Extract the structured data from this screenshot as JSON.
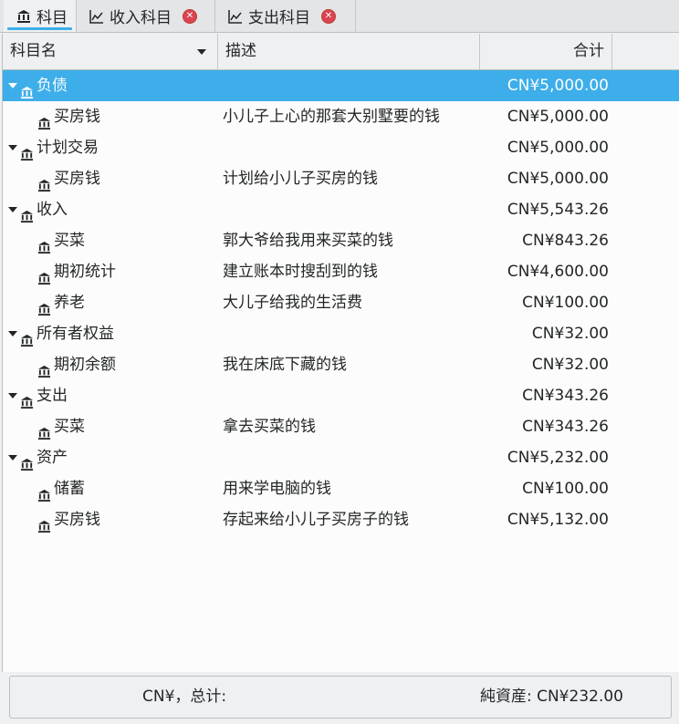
{
  "tabs": [
    {
      "label": "科目",
      "icon": "bank-icon",
      "active": true,
      "closable": false
    },
    {
      "label": "收入科目",
      "icon": "chart-icon",
      "active": false,
      "closable": true
    },
    {
      "label": "支出科目",
      "icon": "chart-icon",
      "active": false,
      "closable": true
    }
  ],
  "columns": {
    "name": "科目名",
    "desc": "描述",
    "total": "合计"
  },
  "rows": [
    {
      "name": "负债",
      "desc": "",
      "total": "CN¥5,000.00",
      "level": 0,
      "expanded": true,
      "selected": true
    },
    {
      "name": "买房钱",
      "desc": "小儿子上心的那套大别墅要的钱",
      "total": "CN¥5,000.00",
      "level": 1
    },
    {
      "name": "计划交易",
      "desc": "",
      "total": "CN¥5,000.00",
      "level": 0,
      "expanded": true
    },
    {
      "name": "买房钱",
      "desc": "计划给小儿子买房的钱",
      "total": "CN¥5,000.00",
      "level": 1
    },
    {
      "name": "收入",
      "desc": "",
      "total": "CN¥5,543.26",
      "level": 0,
      "expanded": true
    },
    {
      "name": "买菜",
      "desc": "郭大爷给我用来买菜的钱",
      "total": "CN¥843.26",
      "level": 1
    },
    {
      "name": "期初统计",
      "desc": "建立账本时搜刮到的钱",
      "total": "CN¥4,600.00",
      "level": 1
    },
    {
      "name": "养老",
      "desc": "大儿子给我的生活费",
      "total": "CN¥100.00",
      "level": 1
    },
    {
      "name": "所有者权益",
      "desc": "",
      "total": "CN¥32.00",
      "level": 0,
      "expanded": true
    },
    {
      "name": "期初余额",
      "desc": "我在床底下藏的钱",
      "total": "CN¥32.00",
      "level": 1
    },
    {
      "name": "支出",
      "desc": "",
      "total": "CN¥343.26",
      "level": 0,
      "expanded": true
    },
    {
      "name": "买菜",
      "desc": "拿去买菜的钱",
      "total": "CN¥343.26",
      "level": 1
    },
    {
      "name": "资产",
      "desc": "",
      "total": "CN¥5,232.00",
      "level": 0,
      "expanded": true
    },
    {
      "name": "储蓄",
      "desc": "用来学电脑的钱",
      "total": "CN¥100.00",
      "level": 1
    },
    {
      "name": "买房钱",
      "desc": "存起来给小儿子买房子的钱",
      "total": "CN¥5,132.00",
      "level": 1
    }
  ],
  "status": {
    "left": "CN¥，总计:",
    "right": "純資産: CN¥232.00"
  },
  "colors": {
    "accent": "#3daee9",
    "close": "#da4453"
  }
}
